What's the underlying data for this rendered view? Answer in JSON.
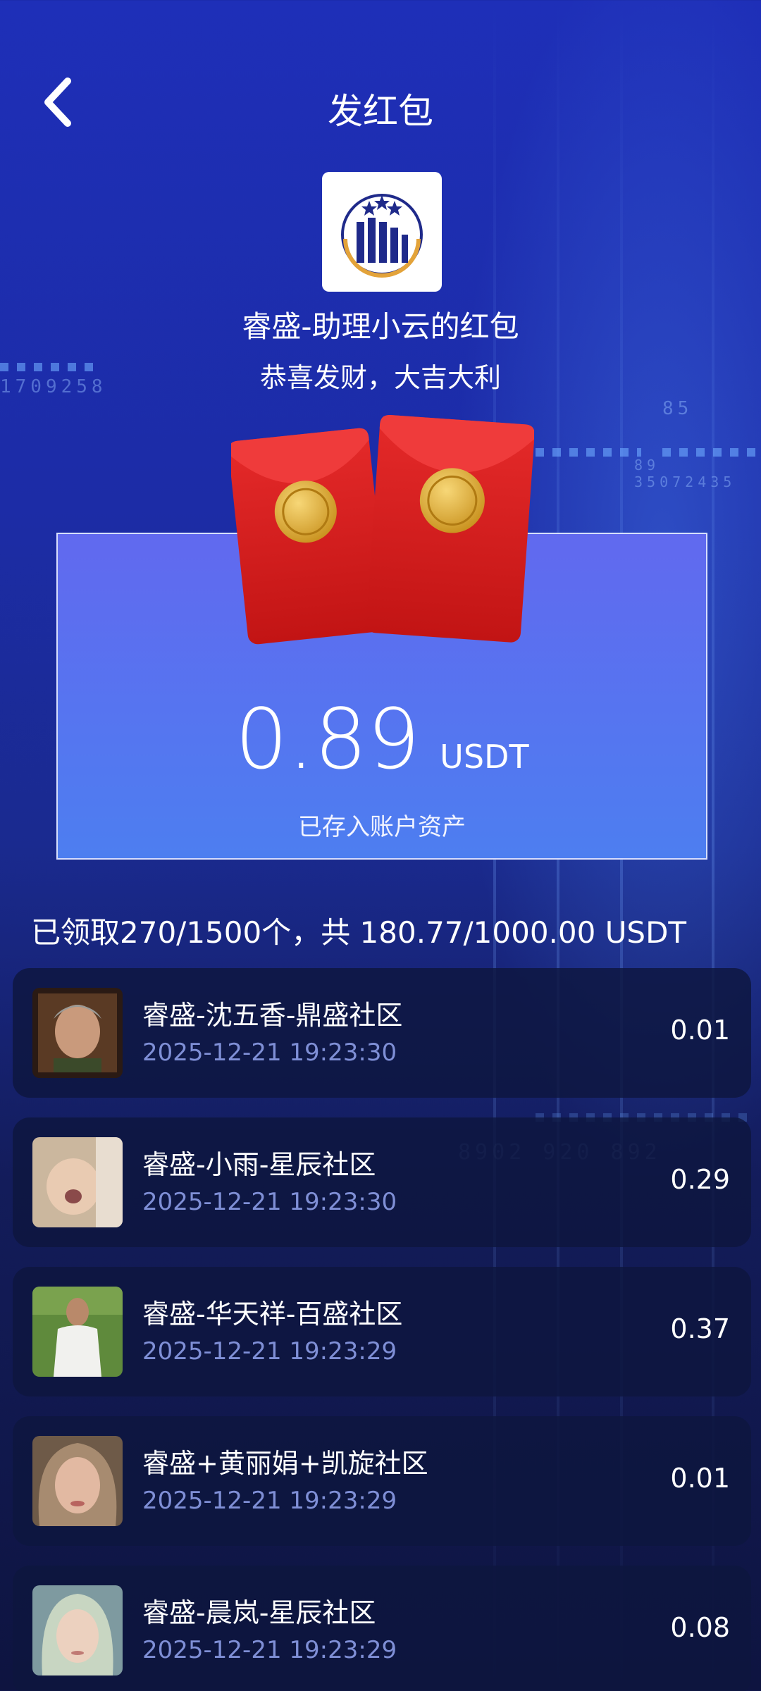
{
  "header": {
    "title": "发红包"
  },
  "packet": {
    "sender": "睿盛-助理小云的红包",
    "wish": "恭喜发财，大吉大利",
    "amount": "0.89",
    "unit": "USDT",
    "note": "已存入账户资产"
  },
  "summary": "已领取270/1500个，共 180.77/1000.00 USDT",
  "records": [
    {
      "name": "睿盛-沈五香-鼎盛社区",
      "time": "2025-12-21 19:23:30",
      "amount": "0.01"
    },
    {
      "name": "睿盛-小雨-星辰社区",
      "time": "2025-12-21 19:23:30",
      "amount": "0.29"
    },
    {
      "name": "睿盛-华天祥-百盛社区",
      "time": "2025-12-21 19:23:29",
      "amount": "0.37"
    },
    {
      "name": "睿盛+黄丽娟+凯旋社区",
      "time": "2025-12-21 19:23:29",
      "amount": "0.01"
    },
    {
      "name": "睿盛-晨岚-星辰社区",
      "time": "2025-12-21 19:23:29",
      "amount": "0.08"
    }
  ],
  "icons": {
    "back": "chevron-left-icon",
    "logo": "ruisheng-logo"
  },
  "colors": {
    "card_top": "#6169ef",
    "card_bottom": "#4d7ef0",
    "envelope_red": "#d91d1d",
    "coin_gold": "#e4b43a",
    "time_text": "#7f8fd6"
  }
}
